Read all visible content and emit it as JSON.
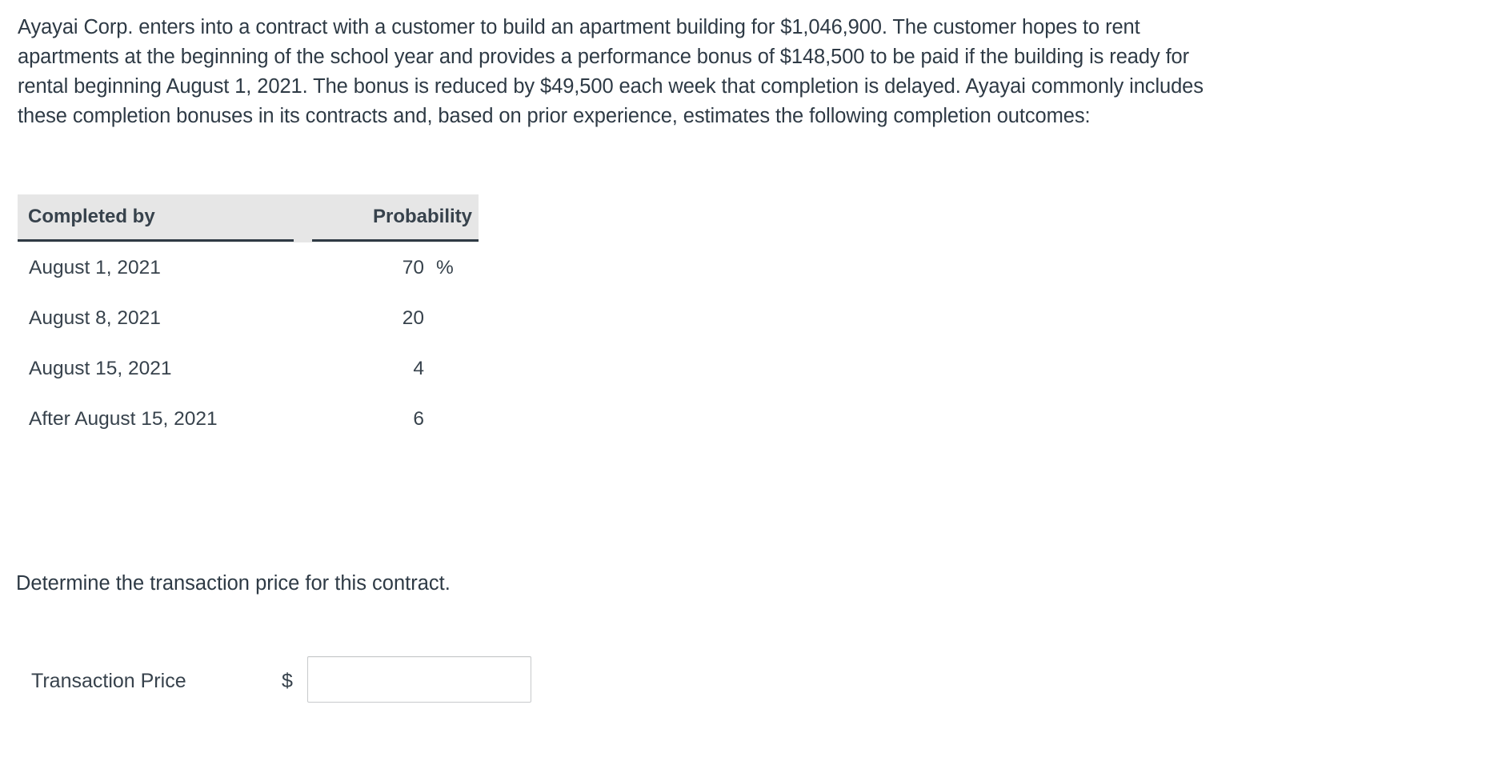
{
  "problem": {
    "paragraph_lines": [
      "Ayayai Corp. enters into a contract with a customer to build an apartment building for $1,046,900. The customer hopes to rent",
      "apartments at the beginning of the school year and provides a performance bonus of $148,500 to be paid if the building is ready for",
      "rental beginning August 1, 2021. The bonus is reduced by $49,500 each week that completion is delayed. Ayayai commonly includes",
      "these completion bonuses in its contracts and, based on prior experience, estimates the following completion outcomes:"
    ],
    "contract_price": "$1,046,900",
    "performance_bonus": "$148,500",
    "weekly_reduction": "$49,500",
    "bonus_deadline": "August 1, 2021",
    "company": "Ayayai Corp."
  },
  "table": {
    "headers": {
      "completed_by": "Completed by",
      "probability": "Probability"
    },
    "rows": [
      {
        "completed_by": "August 1, 2021",
        "probability": "70",
        "unit": "%"
      },
      {
        "completed_by": "August 8, 2021",
        "probability": "20",
        "unit": ""
      },
      {
        "completed_by": "August 15, 2021",
        "probability": "4",
        "unit": ""
      },
      {
        "completed_by": "After August 15, 2021",
        "probability": "6",
        "unit": ""
      }
    ]
  },
  "question": {
    "prompt": "Determine the transaction price for this contract."
  },
  "answer": {
    "label": "Transaction Price",
    "currency_symbol": "$",
    "value": "",
    "placeholder": ""
  },
  "colors": {
    "text": "#2e3a45",
    "header_background": "#e6e6e6",
    "header_rule": "#2f3a44",
    "input_border": "#c8cacc",
    "page_background": "#ffffff"
  }
}
